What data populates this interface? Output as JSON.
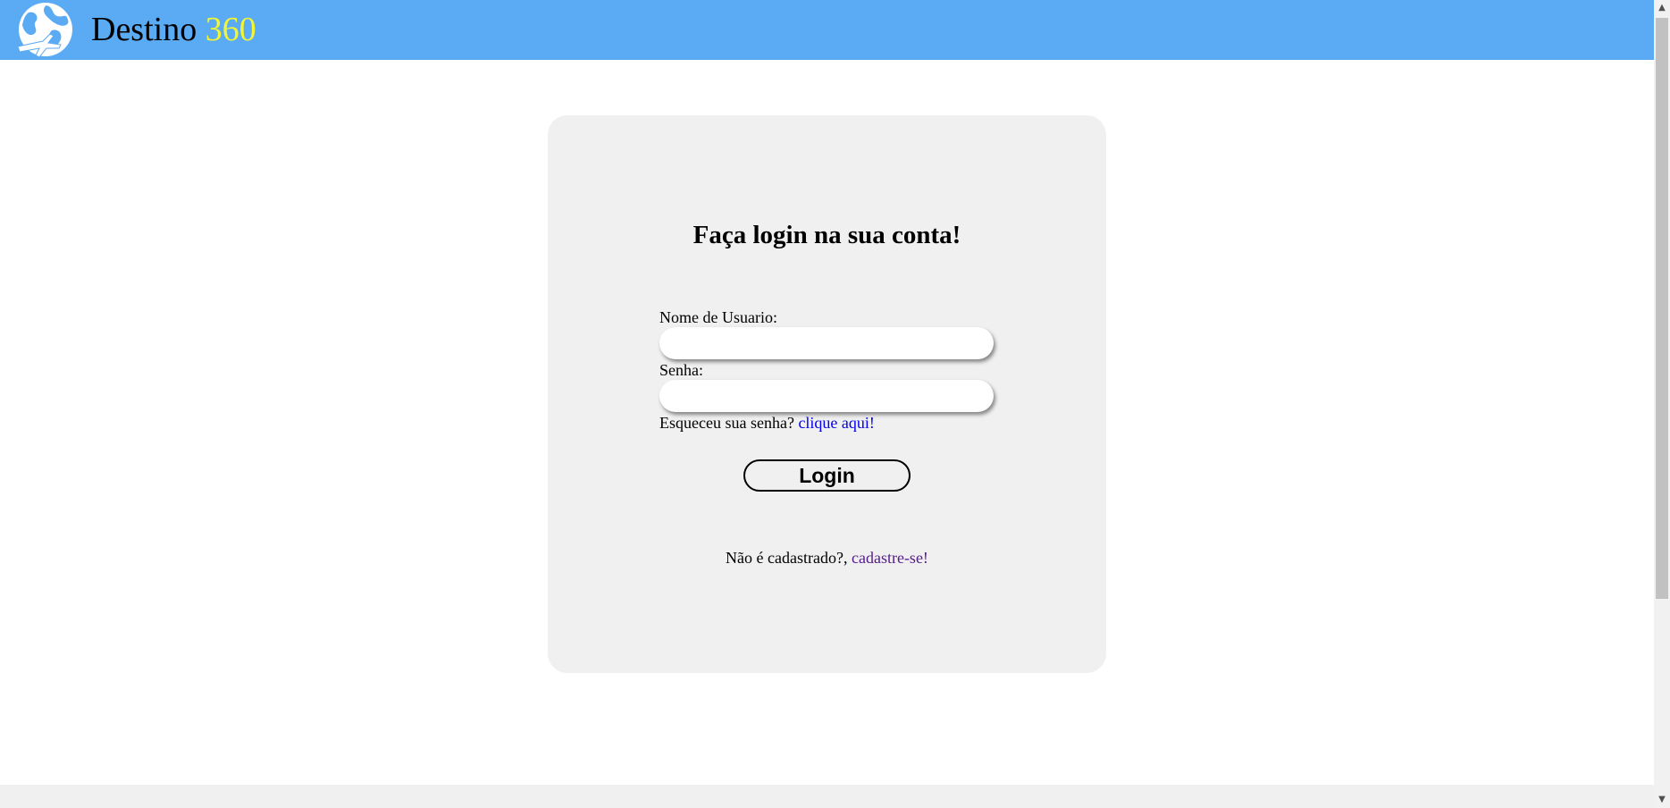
{
  "header": {
    "brand_name": "Destino",
    "brand_number": "360",
    "colors": {
      "bar": "#5aaaf4",
      "accent": "#f2f534"
    },
    "logo_icon": "globe-airplane-icon"
  },
  "login": {
    "title": "Faça login na sua conta!",
    "username_label": "Nome de Usuario:",
    "username_value": "",
    "password_label": "Senha:",
    "password_value": "",
    "forgot_text": "Esqueceu sua senha?",
    "forgot_link": "clique aqui!",
    "submit_label": "Login",
    "register_text": "Não é cadastrado?,",
    "register_link": "cadastre-se!"
  }
}
